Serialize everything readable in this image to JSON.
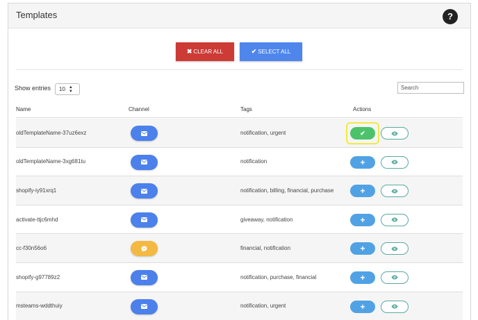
{
  "header": {
    "title": "Templates",
    "help_label": "?"
  },
  "toolbar": {
    "clear_all_label": "CLEAR ALL",
    "select_all_label": "SELECT ALL"
  },
  "list_controls": {
    "show_entries_label": "Show entries",
    "entries_value": "10",
    "search_placeholder": "Search"
  },
  "table": {
    "columns": [
      "Name",
      "Channel",
      "Tags",
      "Actions"
    ],
    "rows": [
      {
        "name": "oldTemplateName-37uz6exz",
        "channel": "email-icon",
        "tags": "notification, urgent",
        "selected": true
      },
      {
        "name": "oldTemplateName-3xg681tu",
        "channel": "email-icon",
        "tags": "notification",
        "selected": false
      },
      {
        "name": "shopify-iy91xrq1",
        "channel": "email-icon",
        "tags": "notification, billing, financial, purchase",
        "selected": false
      },
      {
        "name": "activate-ttjc6mhd",
        "channel": "email-icon",
        "tags": "giveaway, notification",
        "selected": false
      },
      {
        "name": "cc-f30n56o6",
        "channel": "chat-icon",
        "tags": "financial, notification",
        "selected": false
      },
      {
        "name": "shopify-g97789z2",
        "channel": "email-icon",
        "tags": "notification, purchase, financial",
        "selected": false
      },
      {
        "name": "msteams-wddthuiy",
        "channel": "email-icon",
        "tags": "notification, urgent",
        "selected": false
      }
    ]
  },
  "colors": {
    "clear_all": "#cc3b35",
    "select_all": "#4f86ec",
    "email_channel": "#4c80eb",
    "chat_channel": "#f3b942",
    "add_action": "#50a2e4",
    "selected_action": "#4cc36a",
    "highlight": "#f1ea45",
    "view_border": "#58a99f"
  }
}
